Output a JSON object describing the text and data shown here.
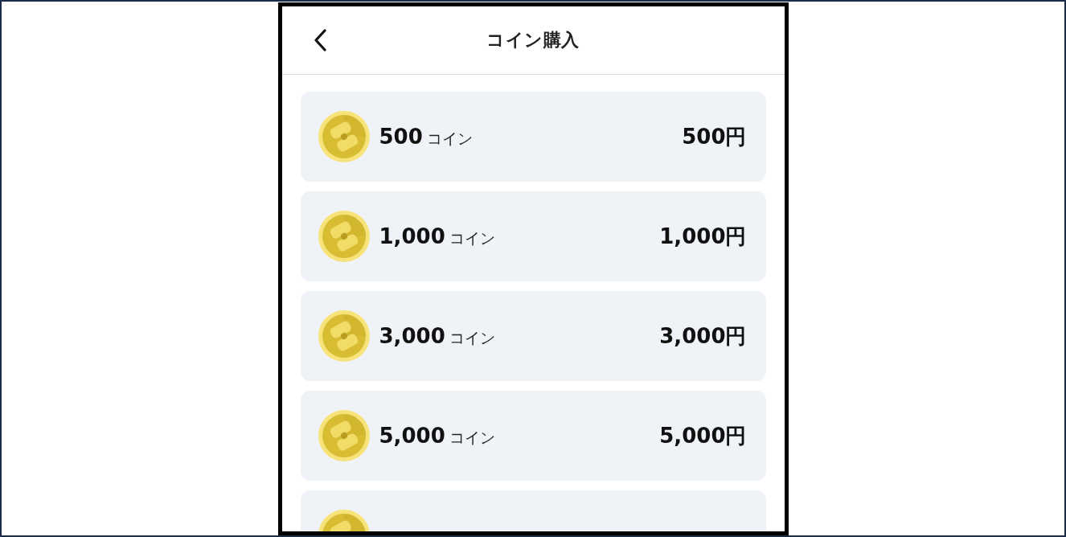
{
  "header": {
    "title": "コイン購入"
  },
  "coin_packages": [
    {
      "kind": "full",
      "amount": "500",
      "unit": "コイン",
      "price": "500円"
    },
    {
      "kind": "full",
      "amount": "1,000",
      "unit": "コイン",
      "price": "1,000円"
    },
    {
      "kind": "full",
      "amount": "3,000",
      "unit": "コイン",
      "price": "3,000円"
    },
    {
      "kind": "full",
      "amount": "5,000",
      "unit": "コイン",
      "price": "5,000円"
    },
    {
      "kind": "cut_off"
    }
  ]
}
